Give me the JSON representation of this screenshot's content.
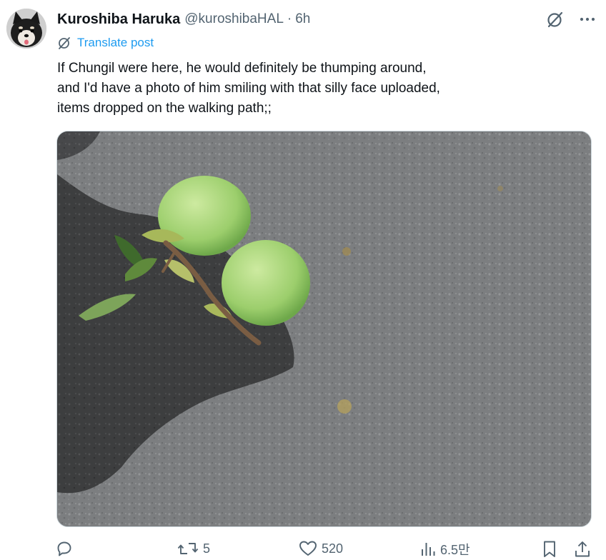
{
  "post": {
    "author": {
      "display_name": "Kuroshiba Haruka",
      "handle": "@kuroshibaHAL",
      "separator": "·",
      "time": "6h",
      "avatar_icon": "shiba-dog-avatar"
    },
    "translate_label": "Translate post",
    "text_lines": [
      "If Chungil were here, he would definitely be thumping around,",
      "and I'd have a photo of him smiling with that silly face uploaded,",
      "items dropped on the walking path;;"
    ],
    "media_icon": "photo-two-green-fruits-on-asphalt",
    "top_actions": {
      "grok_icon": "slash-circle-icon",
      "more_icon": "more-horizontal-icon"
    },
    "actions": {
      "reply_count": "",
      "repost_count": "5",
      "like_count": "520",
      "views_count": "6.5만",
      "bookmark_icon": "bookmark-icon",
      "share_icon": "share-icon"
    },
    "colors": {
      "accent": "#1d9bf0",
      "secondary_text": "#536471",
      "primary_text": "#0f1419"
    }
  }
}
